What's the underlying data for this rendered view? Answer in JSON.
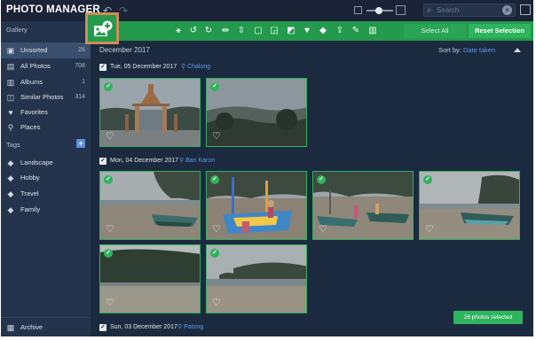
{
  "app": {
    "title": "PHOTO MANAGER"
  },
  "search": {
    "placeholder": "Search"
  },
  "sidebar": {
    "gallery_label": "Gallery",
    "items": [
      {
        "label": "Unsorted",
        "count": "26",
        "icon": "inbox-icon"
      },
      {
        "label": "All Photos",
        "count": "708",
        "icon": "photos-icon"
      },
      {
        "label": "Albums",
        "count": "1",
        "icon": "album-icon"
      },
      {
        "label": "Similar Photos",
        "count": "314",
        "icon": "similar-icon"
      },
      {
        "label": "Favorites",
        "count": "",
        "icon": "heart-icon"
      },
      {
        "label": "Places",
        "count": "",
        "icon": "map-pin-icon"
      }
    ],
    "tags_label": "Tags",
    "tags": [
      {
        "label": "Landscape"
      },
      {
        "label": "Hobby"
      },
      {
        "label": "Travel"
      },
      {
        "label": "Family"
      }
    ],
    "archive_label": "Archive"
  },
  "toolbar": {
    "icons": [
      "magic-wand-icon",
      "rotate-left-icon",
      "rotate-right-icon",
      "flip-horizontal-icon",
      "flip-vertical-icon",
      "crop-icon",
      "resize-icon",
      "translate-icon",
      "heart-icon",
      "tag-icon",
      "share-icon",
      "edit-icon",
      "trash-icon"
    ],
    "select_all": "Select All",
    "reset_selection": "Reset Selection"
  },
  "content": {
    "month": "December 2017",
    "sort_label": "Sort by:",
    "sort_value": "Date taken",
    "groups": [
      {
        "date": "Tue, 05 December 2017",
        "place": "Chalong"
      },
      {
        "date": "Mon, 04 December 2017",
        "place": "Ban Karon"
      },
      {
        "date": "Sun, 03 December 2017",
        "place": "Patong"
      }
    ],
    "status": "26 photos selected"
  },
  "colors": {
    "accent_green": "#239a4c",
    "highlight_orange": "#d48a5a",
    "link_blue": "#5c9be6"
  }
}
